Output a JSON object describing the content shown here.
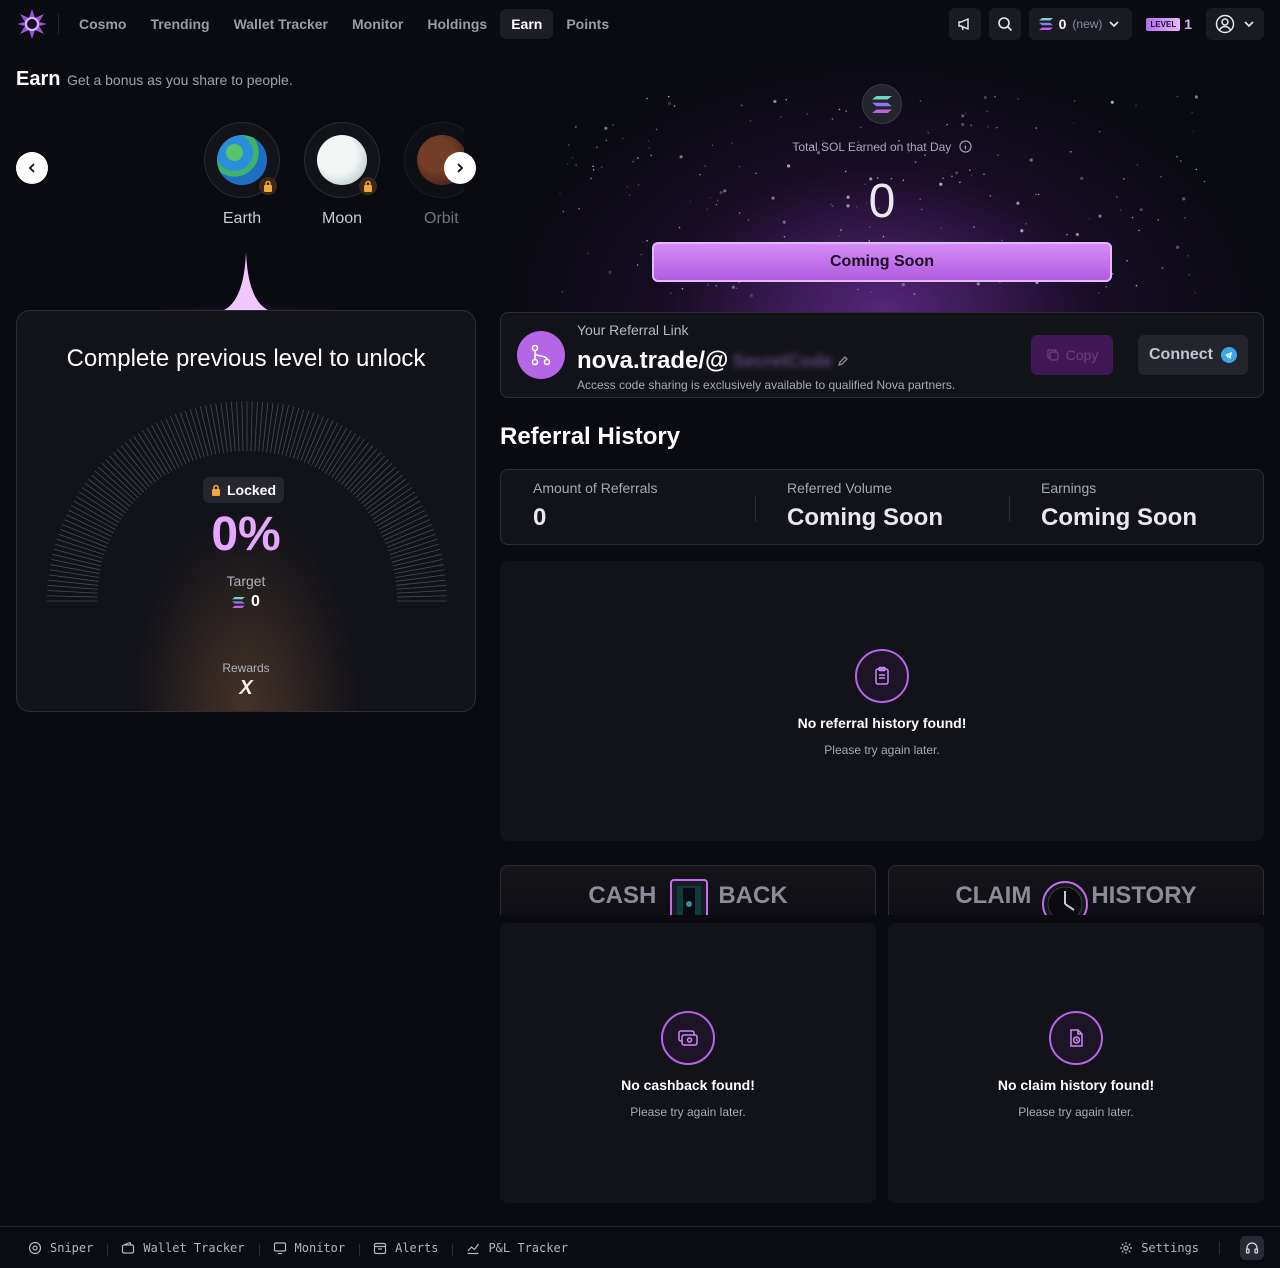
{
  "nav": {
    "links": [
      {
        "label": "Cosmo",
        "active": false
      },
      {
        "label": "Trending",
        "active": false
      },
      {
        "label": "Wallet Tracker",
        "active": false
      },
      {
        "label": "Monitor",
        "active": false
      },
      {
        "label": "Holdings",
        "active": false
      },
      {
        "label": "Earn",
        "active": true
      },
      {
        "label": "Points",
        "active": false
      }
    ],
    "wallet_amount": "0",
    "wallet_tag": "(new)",
    "level_label": "LEVEL",
    "level_value": "1"
  },
  "earn": {
    "title": "Earn",
    "subtitle": "Get a bonus as you share to people."
  },
  "levels": [
    {
      "name": "Earth",
      "locked": true
    },
    {
      "name": "Moon",
      "locked": true
    },
    {
      "name": "Orbit",
      "locked": false
    }
  ],
  "lock_card": {
    "title": "Complete previous level to unlock",
    "status": "Locked",
    "progress_percent": "0%",
    "target_label": "Target",
    "target_value": "0",
    "rewards_label": "Rewards",
    "rewards_value": "X"
  },
  "hero": {
    "label": "Total SOL Earned on that Day",
    "value": "0",
    "button": "Coming Soon"
  },
  "referral": {
    "label": "Your Referral Link",
    "link_prefix": "nova.trade/@",
    "code": "SecretCode",
    "note": "Access code sharing is exclusively available to qualified Nova partners.",
    "copy_label": "Copy",
    "connect_label": "Connect"
  },
  "history": {
    "title": "Referral History",
    "stats": [
      {
        "label": "Amount of Referrals",
        "value": "0"
      },
      {
        "label": "Referred Volume",
        "value": "Coming Soon"
      },
      {
        "label": "Earnings",
        "value": "Coming Soon"
      }
    ],
    "empty_title": "No referral history found!",
    "empty_sub": "Please try again later."
  },
  "cashback": {
    "tab_left": "CASH",
    "tab_right": "BACK",
    "empty_title": "No cashback found!",
    "empty_sub": "Please try again later."
  },
  "claim": {
    "tab_left": "CLAIM",
    "tab_right": "HISTORY",
    "empty_title": "No claim history found!",
    "empty_sub": "Please try again later."
  },
  "bottom": {
    "items": [
      "Sniper",
      "Wallet Tracker",
      "Monitor",
      "Alerts",
      "P&L Tracker"
    ],
    "settings": "Settings"
  },
  "colors": {
    "accent": "#b566e6",
    "background": "#0a0a11",
    "panel": "#121219"
  }
}
